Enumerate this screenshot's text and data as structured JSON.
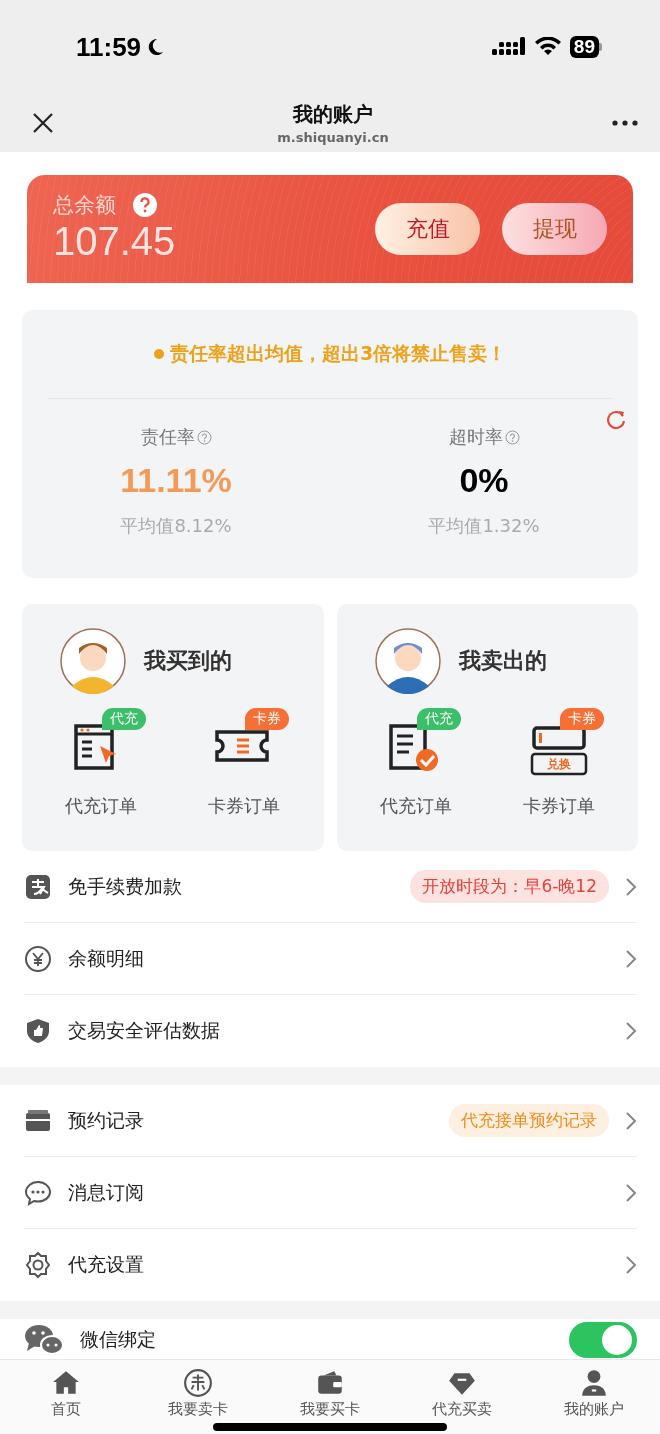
{
  "status_bar": {
    "time": "11:59",
    "battery": "89"
  },
  "nav": {
    "title": "我的账户",
    "url": "m.shiquanyi.cn"
  },
  "balance": {
    "label": "总余额",
    "amount": "107.45",
    "buttons": [
      {
        "label": "充值",
        "kind": "recharge"
      },
      {
        "label": "提现",
        "kind": "withdraw"
      }
    ]
  },
  "rates": {
    "notice": "责任率超出均值，超出3倍将禁止售卖！",
    "metrics": [
      {
        "label": "责任率",
        "value": "11.11%",
        "average": "平均值8.12%",
        "alert": true
      },
      {
        "label": "超时率",
        "value": "0%",
        "average": "平均值1.32%",
        "alert": false
      }
    ]
  },
  "order_panels": [
    {
      "title": "我买到的",
      "items": [
        {
          "label": "代充订单",
          "badge": "代充",
          "kind": "recharge"
        },
        {
          "label": "卡券订单",
          "badge": "卡券",
          "kind": "coupon"
        }
      ]
    },
    {
      "title": "我卖出的",
      "items": [
        {
          "label": "代充订单",
          "badge": "代充",
          "kind": "recharge-done"
        },
        {
          "label": "卡券订单",
          "badge": "卡券",
          "kind": "exchange",
          "icon_text": "兑换"
        }
      ]
    }
  ],
  "menu_groups": [
    [
      {
        "label": "免手续费加款",
        "tag": {
          "text": "开放时段为：早6-晚12",
          "kind": "alert"
        }
      },
      {
        "label": "余额明细"
      },
      {
        "label": "交易安全评估数据"
      }
    ],
    [
      {
        "label": "预约记录",
        "tag": {
          "text": "代充接单预约记录",
          "kind": "info"
        }
      },
      {
        "label": "消息订阅"
      },
      {
        "label": "代充设置"
      }
    ]
  ],
  "wechat": {
    "label": "微信绑定",
    "on": true
  },
  "tabs": [
    {
      "label": "首页"
    },
    {
      "label": "我要卖卡"
    },
    {
      "label": "我要买卡"
    },
    {
      "label": "代充买卖"
    },
    {
      "label": "我的账户"
    }
  ]
}
